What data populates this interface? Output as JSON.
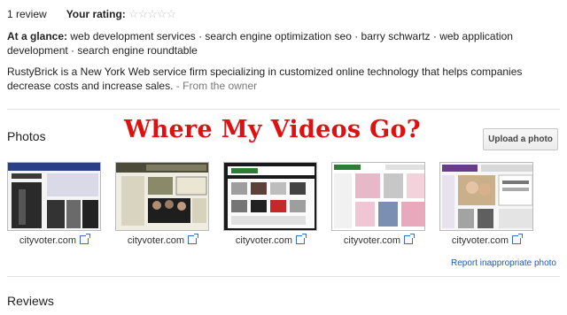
{
  "summary": {
    "review_count": "1 review",
    "your_rating_label": "Your rating:",
    "stars": "☆☆☆☆☆"
  },
  "glance": {
    "label": "At a glance:",
    "text": "web development services · search engine optimization seo · barry schwartz · web application development · search engine roundtable"
  },
  "description": {
    "text": "RustyBrick is a New York Web service firm specializing in customized online technology that helps companies decrease costs and increase sales.",
    "source": "- From the owner"
  },
  "photos": {
    "heading": "Photos",
    "overlay_title": "Where My Videos Go?",
    "upload_label": "Upload a photo",
    "items": [
      {
        "caption": "cityvoter.com"
      },
      {
        "caption": "cityvoter.com"
      },
      {
        "caption": "cityvoter.com"
      },
      {
        "caption": "cityvoter.com"
      },
      {
        "caption": "cityvoter.com"
      }
    ],
    "report_label": "Report inappropriate photo"
  },
  "reviews": {
    "heading": "Reviews"
  },
  "colors": {
    "overlay_red": "#e01010",
    "link_blue": "#1a57c6"
  }
}
